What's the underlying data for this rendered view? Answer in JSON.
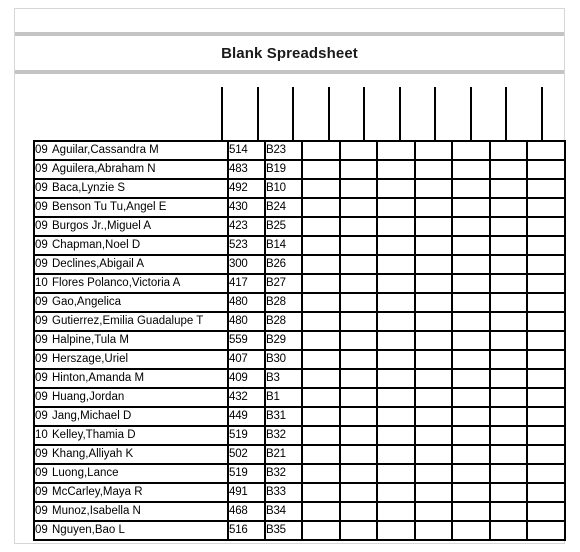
{
  "document": {
    "title": "Blank Spreadsheet"
  },
  "colors": {
    "code_red": "#ff0000",
    "grid_black": "#000000",
    "separator_gray": "#c4c4c4",
    "page_border": "#d6d6d6"
  },
  "table": {
    "column_rule_count": 10,
    "blank_column_count": 7,
    "row_count": 19,
    "rows": [
      {
        "grade": "09",
        "name": "Aguilar,Cassandra M",
        "score": "514",
        "code": "B23"
      },
      {
        "grade": "09",
        "name": "Aguilera,Abraham N",
        "score": "483",
        "code": "B19"
      },
      {
        "grade": "09",
        "name": "Baca,Lynzie S",
        "score": "492",
        "code": "B10"
      },
      {
        "grade": "09",
        "name": "Benson Tu Tu,Angel E",
        "score": "430",
        "code": "B24"
      },
      {
        "grade": "09",
        "name": "Burgos Jr.,Miguel A",
        "score": "423",
        "code": "B25"
      },
      {
        "grade": "09",
        "name": "Chapman,Noel D",
        "score": "523",
        "code": "B14"
      },
      {
        "grade": "09",
        "name": "Declines,Abigail A",
        "score": "300",
        "code": "B26"
      },
      {
        "grade": "10",
        "name": "Flores Polanco,Victoria A",
        "score": "417",
        "code": "B27"
      },
      {
        "grade": "09",
        "name": "Gao,Angelica",
        "score": "480",
        "code": "B28"
      },
      {
        "grade": "09",
        "name": "Gutierrez,Emilia Guadalupe T",
        "score": "480",
        "code": "B28"
      },
      {
        "grade": "09",
        "name": "Halpine,Tula M",
        "score": "559",
        "code": "B29"
      },
      {
        "grade": "09",
        "name": "Herszage,Uriel",
        "score": "407",
        "code": "B30"
      },
      {
        "grade": "09",
        "name": "Hinton,Amanda M",
        "score": "409",
        "code": "B3"
      },
      {
        "grade": "09",
        "name": "Huang,Jordan",
        "score": "432",
        "code": "B1"
      },
      {
        "grade": "09",
        "name": "Jang,Michael D",
        "score": "449",
        "code": "B31"
      },
      {
        "grade": "10",
        "name": "Kelley,Thamia D",
        "score": "519",
        "code": "B32"
      },
      {
        "grade": "09",
        "name": "Khang,Alliyah K",
        "score": "502",
        "code": "B21"
      },
      {
        "grade": "09",
        "name": "Luong,Lance",
        "score": "519",
        "code": "B32"
      },
      {
        "grade": "09",
        "name": "McCarley,Maya R",
        "score": "491",
        "code": "B33"
      },
      {
        "grade": "09",
        "name": "Munoz,Isabella N",
        "score": "468",
        "code": "B34"
      },
      {
        "grade": "09",
        "name": "Nguyen,Bao L",
        "score": "516",
        "code": "B35"
      }
    ]
  }
}
